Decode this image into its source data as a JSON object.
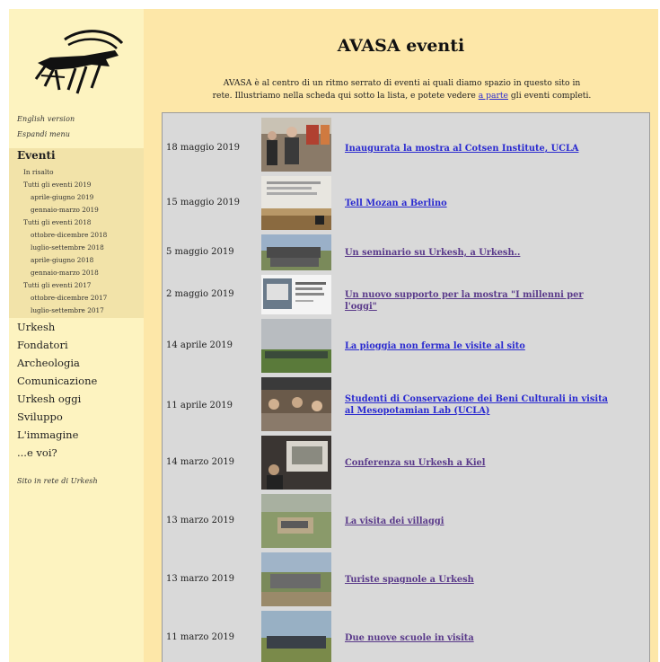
{
  "sidebar": {
    "english": "English version",
    "expand": "Espandi menu",
    "section_title": "Eventi",
    "sub_items": [
      "In risalto",
      "Tutti gli eventi 2019",
      "aprile-giugno 2019",
      "gennaio-marzo 2019",
      "Tutti gli eventi 2018",
      "ottobre-dicembre 2018",
      "luglio-settembre 2018",
      "aprile-giugno 2018",
      "gennaio-marzo 2018",
      "Tutti gli eventi 2017",
      "ottobre-dicembre 2017",
      "luglio-settembre 2017"
    ],
    "main_items": [
      "Urkesh",
      "Fondatori",
      "Archeologia",
      "Comunicazione",
      "Urkesh oggi",
      "Sviluppo",
      "L'immagine",
      "...e voi?"
    ],
    "network": "Sito in rete di Urkesh"
  },
  "main": {
    "title": "AVASA eventi",
    "intro_line1": "AVASA è al centro di un ritmo serrato di eventi ai quali diamo spazio in questo sito in",
    "intro_line2_before": "rete. Illustriamo nella scheda qui sotto la lista, e potete vedere",
    "intro_link": "a parte",
    "intro_line2_after": "gli eventi completi.",
    "events": [
      {
        "date": "18 maggio 2019",
        "title": "Inaugurata la mostra al Cotsen Institute, UCLA"
      },
      {
        "date": "15 maggio 2019",
        "title": "Tell Mozan a Berlino"
      },
      {
        "date": "5 maggio 2019",
        "title": "Un seminario su Urkesh, a Urkesh.."
      },
      {
        "date": "2 maggio 2019",
        "title": "Un nuovo supporto per la mostra \"I millenni per l'oggi\""
      },
      {
        "date": "14 aprile 2019",
        "title": "La pioggia non ferma le visite al sito"
      },
      {
        "date": "11 aprile 2019",
        "title": "Studenti di Conservazione dei Beni Culturali in visita al Mesopotamian Lab (UCLA)"
      },
      {
        "date": "14 marzo 2019",
        "title": "Conferenza su Urkesh a Kiel"
      },
      {
        "date": "13 marzo 2019",
        "title": "La visita dei villaggi"
      },
      {
        "date": "13 marzo 2019",
        "title": "Turiste spagnole a Urkesh"
      },
      {
        "date": "11 marzo 2019",
        "title": "Due nuove scuole in visita"
      }
    ]
  }
}
